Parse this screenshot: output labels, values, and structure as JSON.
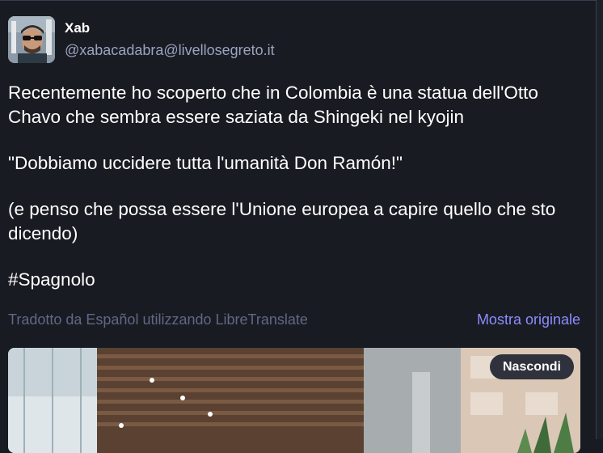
{
  "author": {
    "display_name": "Xab",
    "handle": "@xabacadabra@livellosegreto.it",
    "avatar_icon": "user-avatar-icon"
  },
  "post": {
    "paragraphs": [
      "Recentemente ho scoperto che in Colombia è una statua dell'Otto Chavo che sembra essere saziata da Shingeki nel kyojin",
      "\"Dobbiamo uccidere tutta l'umanità Don Ramón!\"",
      "(e penso che possa essere l'Unione europea a capire quello che sto dicendo)",
      "#Spagnolo"
    ]
  },
  "translation": {
    "note": "Tradotto da Español utilizzando LibreTranslate",
    "show_original_label": "Mostra originale"
  },
  "media": {
    "hide_label": "Nascondi"
  },
  "colors": {
    "background": "#191b22",
    "accent": "#8c8dff",
    "muted": "#606984",
    "handle": "#9aa3c0"
  }
}
